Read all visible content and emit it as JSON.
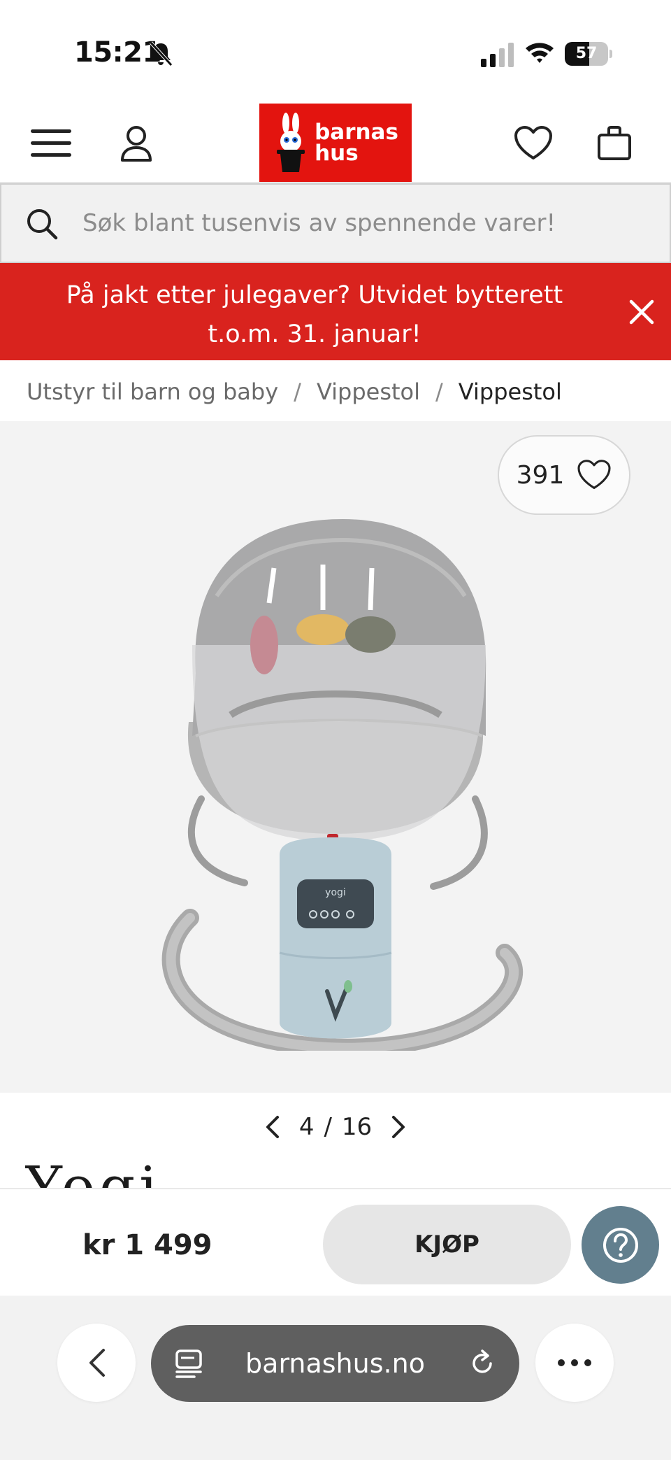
{
  "status_bar": {
    "time": "15:21",
    "battery": "57",
    "battery_level": 0.57,
    "icons": [
      "bell-slash-icon",
      "cellular-signal-icon",
      "wifi-icon",
      "battery-icon"
    ]
  },
  "header": {
    "logo_line1": "barnas",
    "logo_line2": "hus",
    "icons": [
      "hamburger-menu-icon",
      "user-account-icon",
      "heart-icon",
      "shopping-bag-icon"
    ],
    "brand_color": "#e3140f"
  },
  "search": {
    "placeholder": "Søk blant tusenvis av spennende varer!"
  },
  "promo": {
    "text": "På jakt etter julegaver? Utvidet bytterett t.o.m. 31. januar!",
    "color": "#d9231e"
  },
  "breadcrumb": {
    "items": [
      "Utstyr til barn og baby",
      "Vippestol",
      "Vippestol"
    ],
    "separator": "/"
  },
  "gallery": {
    "wishlist_count": "391",
    "current": "4",
    "separator": "/",
    "total": "16"
  },
  "product": {
    "brand_peek": "Yogi"
  },
  "buy_bar": {
    "price": "kr 1 499",
    "buy_label": "KJØP",
    "help_color": "#627f8e"
  },
  "browser": {
    "url": "barnashus.no"
  }
}
